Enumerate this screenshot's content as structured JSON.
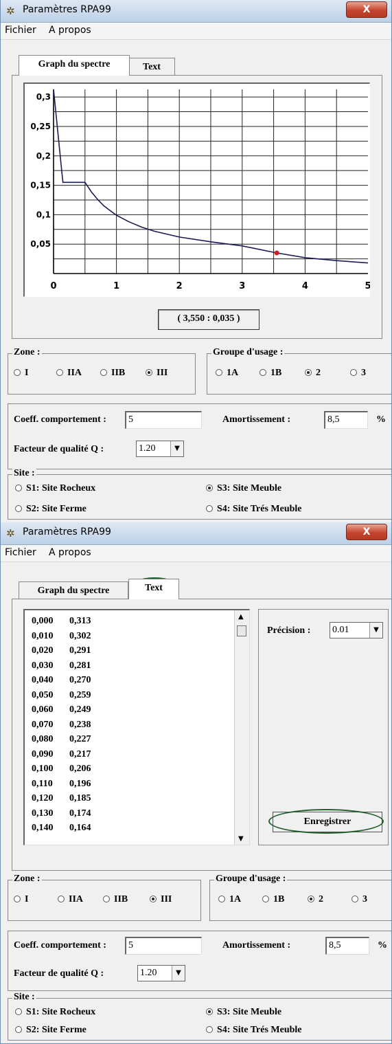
{
  "window": {
    "title": "Paramètres RPA99",
    "close_label": "X"
  },
  "menu": [
    "Fichier",
    "A propos"
  ],
  "tabs": [
    "Graph du spectre",
    "Text"
  ],
  "chart_data": {
    "type": "line",
    "xlim": [
      0,
      5
    ],
    "ylim": [
      0,
      0.313
    ],
    "x_ticks": [
      "0",
      "1",
      "2",
      "3",
      "4",
      "5"
    ],
    "y_ticks": [
      "0,3",
      "0,25",
      "0,2",
      "0,15",
      "0,1",
      "0,05"
    ],
    "grid": true,
    "series": [
      {
        "x": [
          0,
          0.14,
          0.15,
          0.2,
          0.3,
          0.4,
          0.5,
          0.6,
          0.7,
          0.8,
          0.9,
          1.0,
          1.2,
          1.4,
          1.6,
          1.8,
          2.0,
          2.5,
          3.0,
          3.55,
          4.0,
          4.5,
          5.0
        ],
        "y": [
          0.313,
          0.164,
          0.155,
          0.155,
          0.155,
          0.155,
          0.155,
          0.139,
          0.126,
          0.115,
          0.107,
          0.099,
          0.088,
          0.079,
          0.072,
          0.067,
          0.062,
          0.054,
          0.047,
          0.035,
          0.027,
          0.022,
          0.018
        ]
      }
    ],
    "marker": {
      "x": 3.55,
      "y": 0.035
    }
  },
  "coord_readout": "( 3,550 : 0,035 )",
  "zone": {
    "legend": "Zone :",
    "options": [
      "I",
      "IIA",
      "IIB",
      "III"
    ],
    "selected": "III"
  },
  "groupe": {
    "legend": "Groupe d'usage :",
    "options": [
      "1A",
      "1B",
      "2",
      "3"
    ],
    "selected": "2"
  },
  "params": {
    "coeff_label": "Coeff. comportement :",
    "coeff_value": "5",
    "amort_label": "Amortissement :",
    "amort_value": "8,5",
    "amort_unit": "%",
    "facteur_label": "Facteur de qualité Q :",
    "facteur_value": "1.20"
  },
  "site": {
    "legend": "Site :",
    "options": [
      "S1: Site Rocheux",
      "S3: Site Meuble",
      "S2: Site Ferme",
      "S4: Site Trés Meuble"
    ],
    "selected": "S3: Site Meuble"
  },
  "text_tab": {
    "rows": [
      [
        "0,000",
        "0,313"
      ],
      [
        "0,010",
        "0,302"
      ],
      [
        "0,020",
        "0,291"
      ],
      [
        "0,030",
        "0,281"
      ],
      [
        "0,040",
        "0,270"
      ],
      [
        "0,050",
        "0,259"
      ],
      [
        "0,060",
        "0,249"
      ],
      [
        "0,070",
        "0,238"
      ],
      [
        "0,080",
        "0,227"
      ],
      [
        "0,090",
        "0,217"
      ],
      [
        "0,100",
        "0,206"
      ],
      [
        "0,110",
        "0,196"
      ],
      [
        "0,120",
        "0,185"
      ],
      [
        "0,130",
        "0,174"
      ],
      [
        "0,140",
        "0,164"
      ]
    ],
    "precision_label": "Précision :",
    "precision_value": "0.01",
    "save_label": "Enregistrer"
  }
}
